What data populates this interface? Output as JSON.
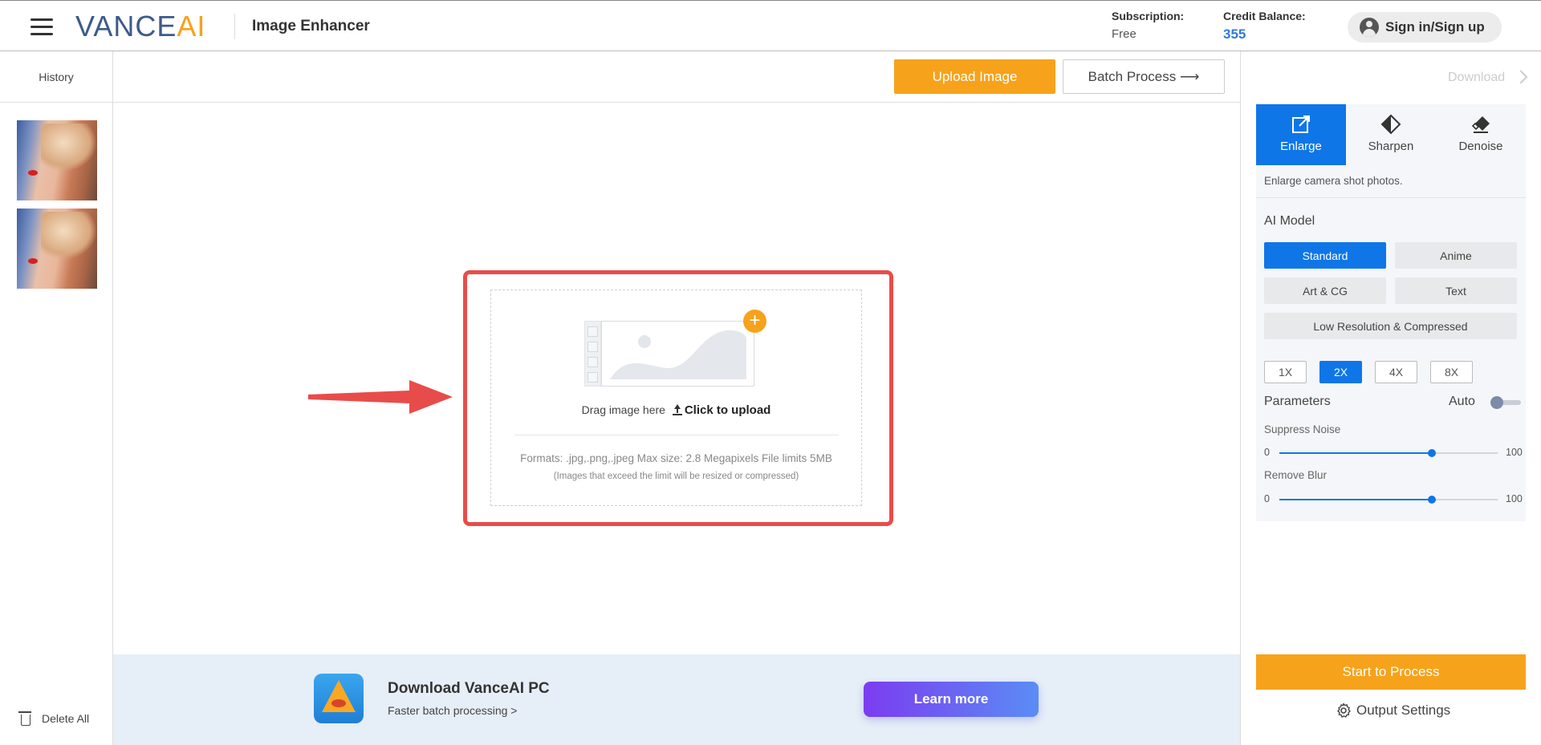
{
  "header": {
    "logo_main": "VANCE",
    "logo_accent": "AI",
    "app_title": "Image Enhancer",
    "subscription_label": "Subscription:",
    "subscription_value": "Free",
    "credit_label": "Credit Balance:",
    "credit_value": "355",
    "signin_label": "Sign in/Sign up"
  },
  "history": {
    "title": "History",
    "thumbnail_count": 2,
    "delete_all_label": "Delete All"
  },
  "toolbar": {
    "upload_label": "Upload Image",
    "batch_label": "Batch Process ⟶"
  },
  "upload": {
    "drag_text": "Drag image here",
    "click_text": "Click to upload",
    "formats_text": "Formats: .jpg,.png,.jpeg Max size: 2.8 Megapixels File limits 5MB",
    "limit_note": "(Images that exceed the limit will be resized or compressed)"
  },
  "promo": {
    "title": "Download VanceAI PC",
    "subtitle": "Faster batch processing >",
    "button_label": "Learn more"
  },
  "panel": {
    "download_label": "Download",
    "tabs": [
      {
        "label": "Enlarge",
        "icon": "enlarge-icon",
        "active": true
      },
      {
        "label": "Sharpen",
        "icon": "sharpen-icon",
        "active": false
      },
      {
        "label": "Denoise",
        "icon": "eraser-icon",
        "active": false
      }
    ],
    "description": "Enlarge camera shot photos.",
    "ai_model_label": "AI Model",
    "models": [
      {
        "label": "Standard",
        "active": true
      },
      {
        "label": "Anime",
        "active": false
      },
      {
        "label": "Art & CG",
        "active": false
      },
      {
        "label": "Text",
        "active": false
      },
      {
        "label": "Low Resolution & Compressed",
        "active": false
      }
    ],
    "scales": [
      {
        "label": "1X",
        "active": false
      },
      {
        "label": "2X",
        "active": true
      },
      {
        "label": "4X",
        "active": false
      },
      {
        "label": "8X",
        "active": false
      }
    ],
    "parameters_label": "Parameters",
    "auto_label": "Auto",
    "auto_enabled": false,
    "suppress_noise": {
      "label": "Suppress Noise",
      "min": "0",
      "max": "100",
      "value": 70
    },
    "remove_blur": {
      "label": "Remove Blur",
      "min": "0",
      "max": "100",
      "value": 70
    },
    "start_label": "Start to Process",
    "output_settings_label": "Output Settings"
  },
  "colors": {
    "accent_orange": "#f7a21b",
    "primary_blue": "#0f76e8",
    "highlight_red": "#e84c4a"
  }
}
